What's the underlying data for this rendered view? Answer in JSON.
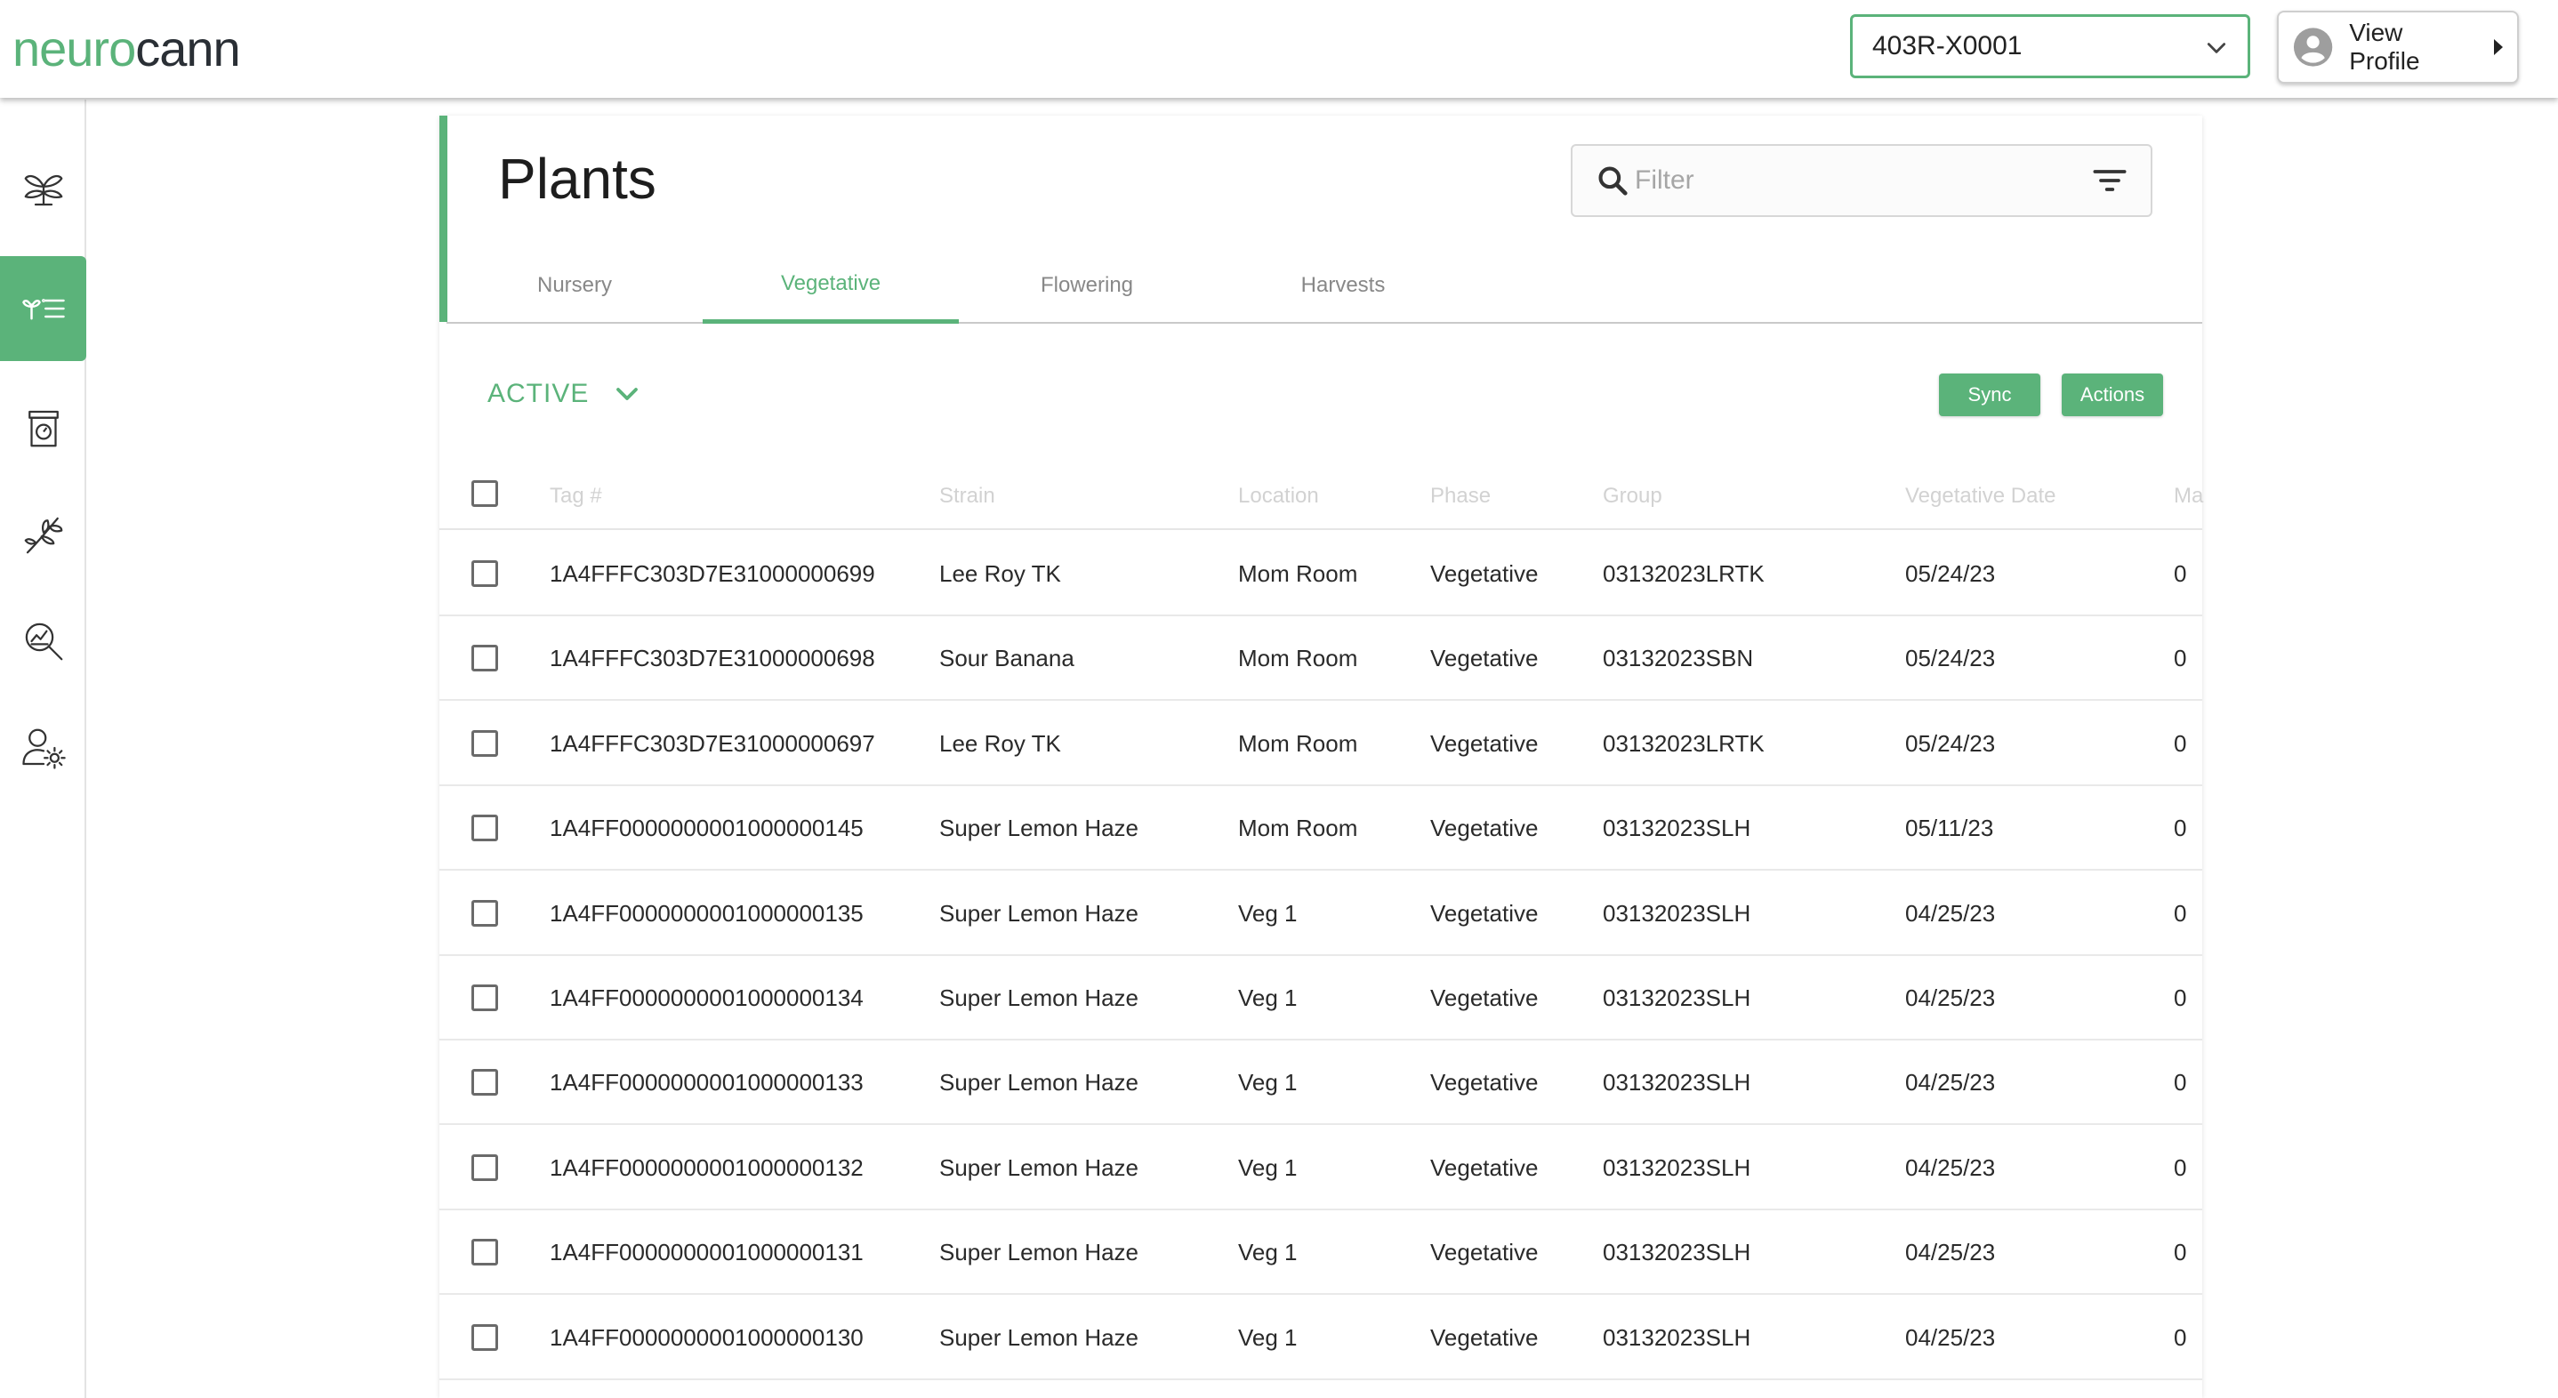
{
  "app": {
    "logo_part1": "neuro",
    "logo_part2": "cann",
    "facility_value": "403R-X0001",
    "profile_label": "View Profile"
  },
  "page": {
    "title": "Plants",
    "filter_placeholder": "Filter",
    "tabs": [
      "Nursery",
      "Vegetative",
      "Flowering",
      "Harvests"
    ],
    "active_tab": "Vegetative",
    "status_filter": "ACTIVE",
    "sync_label": "Sync",
    "actions_label": "Actions"
  },
  "table": {
    "columns": [
      "Tag #",
      "Strain",
      "Location",
      "Phase",
      "Group",
      "Vegetative Date",
      "Ma"
    ],
    "rows": [
      {
        "tag": "1A4FFFC303D7E31000000699",
        "strain": "Lee Roy TK",
        "location": "Mom Room",
        "phase": "Vegetative",
        "group": "03132023LRTK",
        "date": "05/24/23",
        "extra": "0"
      },
      {
        "tag": "1A4FFFC303D7E31000000698",
        "strain": "Sour Banana",
        "location": "Mom Room",
        "phase": "Vegetative",
        "group": "03132023SBN",
        "date": "05/24/23",
        "extra": "0"
      },
      {
        "tag": "1A4FFFC303D7E31000000697",
        "strain": "Lee Roy TK",
        "location": "Mom Room",
        "phase": "Vegetative",
        "group": "03132023LRTK",
        "date": "05/24/23",
        "extra": "0"
      },
      {
        "tag": "1A4FF0000000001000000145",
        "strain": "Super Lemon Haze",
        "location": "Mom Room",
        "phase": "Vegetative",
        "group": "03132023SLH",
        "date": "05/11/23",
        "extra": "0"
      },
      {
        "tag": "1A4FF0000000001000000135",
        "strain": "Super Lemon Haze",
        "location": "Veg 1",
        "phase": "Vegetative",
        "group": "03132023SLH",
        "date": "04/25/23",
        "extra": "0"
      },
      {
        "tag": "1A4FF0000000001000000134",
        "strain": "Super Lemon Haze",
        "location": "Veg 1",
        "phase": "Vegetative",
        "group": "03132023SLH",
        "date": "04/25/23",
        "extra": "0"
      },
      {
        "tag": "1A4FF0000000001000000133",
        "strain": "Super Lemon Haze",
        "location": "Veg 1",
        "phase": "Vegetative",
        "group": "03132023SLH",
        "date": "04/25/23",
        "extra": "0"
      },
      {
        "tag": "1A4FF0000000001000000132",
        "strain": "Super Lemon Haze",
        "location": "Veg 1",
        "phase": "Vegetative",
        "group": "03132023SLH",
        "date": "04/25/23",
        "extra": "0"
      },
      {
        "tag": "1A4FF0000000001000000131",
        "strain": "Super Lemon Haze",
        "location": "Veg 1",
        "phase": "Vegetative",
        "group": "03132023SLH",
        "date": "04/25/23",
        "extra": "0"
      },
      {
        "tag": "1A4FF0000000001000000130",
        "strain": "Super Lemon Haze",
        "location": "Veg 1",
        "phase": "Vegetative",
        "group": "03132023SLH",
        "date": "04/25/23",
        "extra": "0"
      }
    ]
  },
  "sidebar": {
    "icons": [
      "nursery-plant-icon",
      "plant-list-icon",
      "scale-icon",
      "harvest-branch-icon",
      "analytics-search-icon",
      "user-settings-icon"
    ],
    "active_index": 1
  },
  "colors": {
    "accent": "#5bb37a",
    "text": "#2a2a2a",
    "muted_header": "#d2d2d2"
  }
}
